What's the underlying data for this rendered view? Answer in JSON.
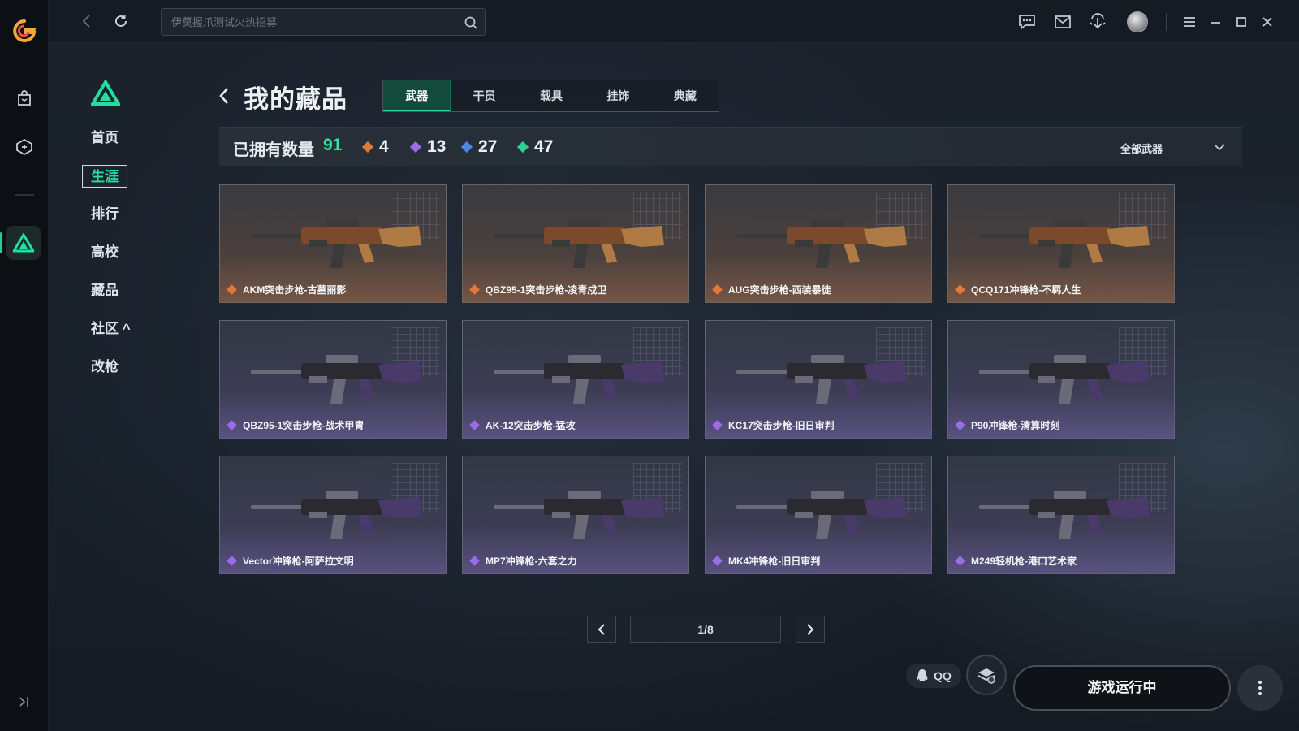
{
  "search": {
    "placeholder": "伊莫握爪测试火热招募"
  },
  "sidebar": {
    "items": [
      {
        "label": "首页"
      },
      {
        "label": "生涯"
      },
      {
        "label": "排行"
      },
      {
        "label": "高校"
      },
      {
        "label": "藏品"
      },
      {
        "label": "社区 ^"
      },
      {
        "label": "改枪"
      }
    ],
    "active_index": 1
  },
  "header": {
    "title": "我的藏品",
    "tabs": [
      {
        "label": "武器"
      },
      {
        "label": "干员"
      },
      {
        "label": "载具"
      },
      {
        "label": "挂饰"
      },
      {
        "label": "典藏"
      }
    ],
    "active_tab": 0
  },
  "stats": {
    "owned_label": "已拥有数量",
    "owned_count": "91",
    "rarities": [
      {
        "count": "4",
        "color": "#e07a3a"
      },
      {
        "count": "13",
        "color": "#9b6be8"
      },
      {
        "count": "27",
        "color": "#4a8be0"
      },
      {
        "count": "47",
        "color": "#2fcf8e"
      }
    ],
    "filter_label": "全部武器"
  },
  "items": [
    {
      "name": "AKM突击步枪-古墓丽影",
      "rarity": "orange"
    },
    {
      "name": "QBZ95-1突击步枪-凌青戍卫",
      "rarity": "orange"
    },
    {
      "name": "AUG突击步枪-西装暴徒",
      "rarity": "orange"
    },
    {
      "name": "QCQ171冲锋枪-不羁人生",
      "rarity": "orange"
    },
    {
      "name": "QBZ95-1突击步枪-战术甲胄",
      "rarity": "purple"
    },
    {
      "name": "AK-12突击步枪-猛攻",
      "rarity": "purple"
    },
    {
      "name": "KC17突击步枪-旧日审判",
      "rarity": "purple"
    },
    {
      "name": "P90冲锋枪-清算时刻",
      "rarity": "purple"
    },
    {
      "name": "Vector冲锋枪-阿萨拉文明",
      "rarity": "purple"
    },
    {
      "name": "MP7冲锋枪-六套之力",
      "rarity": "purple"
    },
    {
      "name": "MK4冲锋枪-旧日审判",
      "rarity": "purple"
    },
    {
      "name": "M249轻机枪-港口艺术家",
      "rarity": "purple"
    }
  ],
  "pagination": {
    "label": "1/8"
  },
  "bottom": {
    "qq_label": "QQ",
    "run_label": "游戏运行中"
  },
  "colors": {
    "accent": "#23e3a2",
    "orange": "#e07a3a",
    "purple": "#9b6be8"
  }
}
